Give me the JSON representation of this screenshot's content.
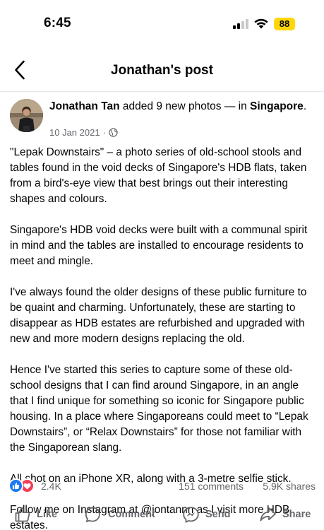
{
  "status_bar": {
    "time": "6:45",
    "battery_level": "88",
    "battery_color": "#ffd60a",
    "signal_bars_active": 2,
    "signal_bars_total": 4
  },
  "nav": {
    "back_icon": "chevron-left-icon",
    "title": "Jonathan's post"
  },
  "post": {
    "author": "Jonathan Tan",
    "action_text": " added 9 new photos — in ",
    "location": "Singapore",
    "location_suffix": ".",
    "date": "10 Jan 2021",
    "separator": "·",
    "audience_icon": "globe-icon",
    "paragraphs": [
      "\"Lepak Downstairs\" – a photo series of old-school stools and tables found in the void decks of Singapore's HDB flats, taken from a bird's-eye view that best brings out their interesting shapes and colours.",
      "Singapore's HDB void decks were built with a communal spirit in mind and the tables are installed to encourage residents to meet and mingle.",
      "I've always found the older designs of these public furniture to be quaint and charming. Unfortunately, these are starting to disappear as HDB estates are refurbished and upgraded with new and more modern designs replacing the old.",
      "Hence I've started this series to capture some of these old-school designs that I can find around Singapore, in an angle that I find unique for something so iconic for Singapore public housing. In a place where Singaporeans could meet to “Lepak Downstairs”, or “Relax Downstairs” for those not familiar with the Singaporean slang.",
      "All shot on an iPhone XR, along with a 3-metre selfie stick.",
      "Follow me on Instagram at @jontannn as I visit more HDB estates."
    ]
  },
  "engagement": {
    "reaction_icons": [
      "like-reaction-icon",
      "love-reaction-icon"
    ],
    "reactions": "2.4K",
    "comments": "151 comments",
    "shares": "5.9K shares",
    "like_color": "#1877f2",
    "love_color": "#f33e58"
  },
  "actions": {
    "like": "Like",
    "comment": "Comment",
    "send": "Send",
    "share": "Share"
  }
}
